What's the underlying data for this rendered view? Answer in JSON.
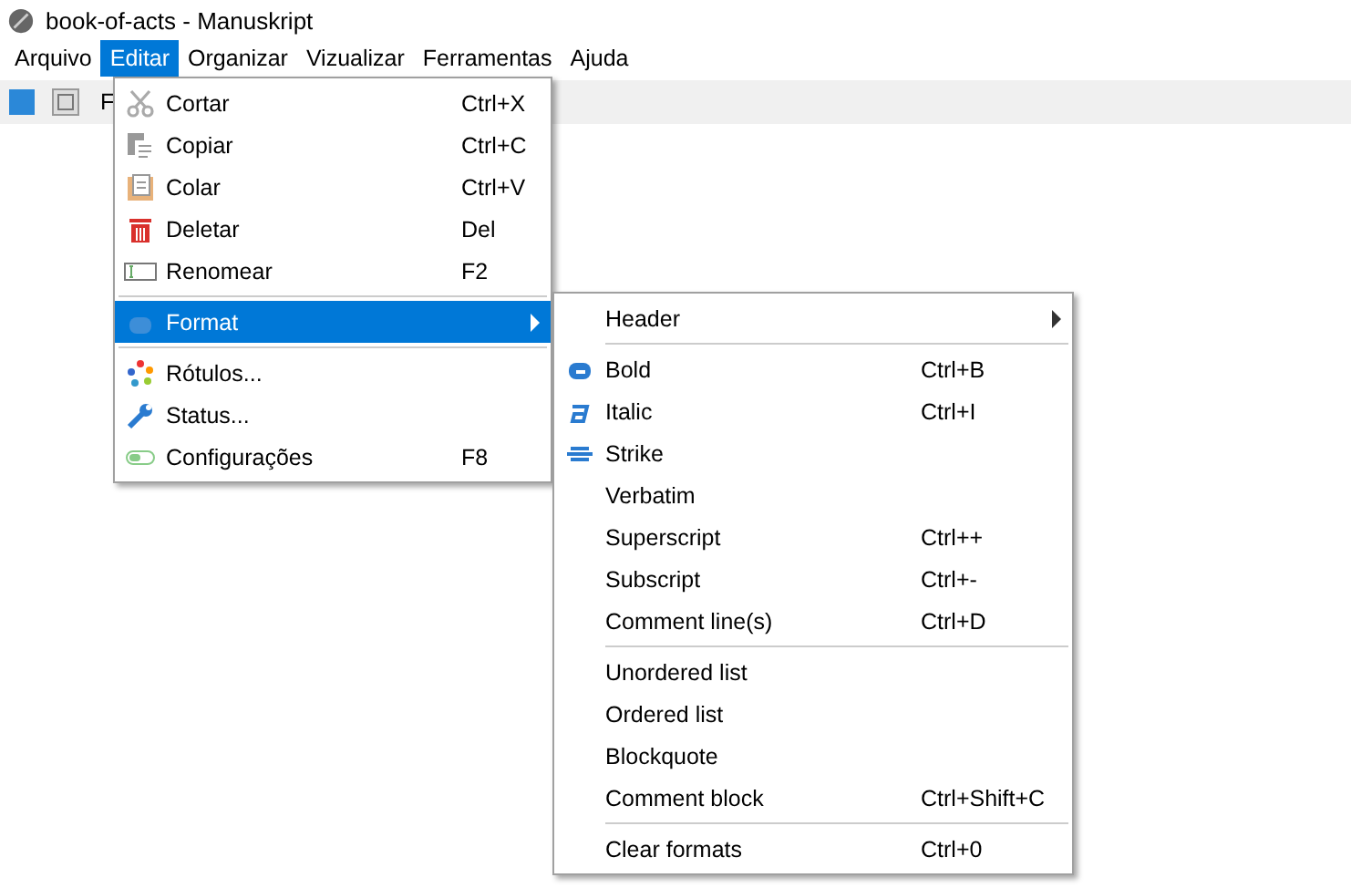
{
  "window": {
    "title": "book-of-acts - Manuskript"
  },
  "menubar": [
    {
      "label": "Arquivo",
      "selected": false
    },
    {
      "label": "Editar",
      "selected": true
    },
    {
      "label": "Organizar",
      "selected": false
    },
    {
      "label": "Vizualizar",
      "selected": false
    },
    {
      "label": "Ferramentas",
      "selected": false
    },
    {
      "label": "Ajuda",
      "selected": false
    }
  ],
  "toolbar": {
    "label": "F"
  },
  "edit_menu": [
    {
      "kind": "item",
      "label": "Cortar",
      "shortcut": "Ctrl+X",
      "selected": false
    },
    {
      "kind": "item",
      "label": "Copiar",
      "shortcut": "Ctrl+C",
      "selected": false
    },
    {
      "kind": "item",
      "label": "Colar",
      "shortcut": "Ctrl+V",
      "selected": false
    },
    {
      "kind": "item",
      "label": "Deletar",
      "shortcut": "Del",
      "selected": false
    },
    {
      "kind": "item",
      "label": "Renomear",
      "shortcut": "F2",
      "selected": false
    },
    {
      "kind": "separator"
    },
    {
      "kind": "submenu",
      "label": "Format",
      "selected": true
    },
    {
      "kind": "separator"
    },
    {
      "kind": "item",
      "label": "Rótulos...",
      "selected": false
    },
    {
      "kind": "item",
      "label": "Status...",
      "selected": false
    },
    {
      "kind": "item",
      "label": "Configurações",
      "shortcut": "F8",
      "selected": false
    }
  ],
  "format_menu": [
    {
      "kind": "submenu",
      "label": "Header",
      "selected": false
    },
    {
      "kind": "separator"
    },
    {
      "kind": "item",
      "label": "Bold",
      "shortcut": "Ctrl+B",
      "selected": false
    },
    {
      "kind": "item",
      "label": "Italic",
      "shortcut": "Ctrl+I",
      "selected": false
    },
    {
      "kind": "item",
      "label": "Strike",
      "selected": false
    },
    {
      "kind": "item",
      "label": "Verbatim",
      "selected": false
    },
    {
      "kind": "item",
      "label": "Superscript",
      "shortcut": "Ctrl++",
      "selected": false
    },
    {
      "kind": "item",
      "label": "Subscript",
      "shortcut": "Ctrl+-",
      "selected": false
    },
    {
      "kind": "item",
      "label": "Comment line(s)",
      "shortcut": "Ctrl+D",
      "selected": false
    },
    {
      "kind": "separator"
    },
    {
      "kind": "item",
      "label": "Unordered list",
      "selected": false
    },
    {
      "kind": "item",
      "label": "Ordered list",
      "selected": false
    },
    {
      "kind": "item",
      "label": "Blockquote",
      "selected": false
    },
    {
      "kind": "item",
      "label": "Comment block",
      "shortcut": "Ctrl+Shift+C",
      "selected": false
    },
    {
      "kind": "separator"
    },
    {
      "kind": "item",
      "label": "Clear formats",
      "shortcut": "Ctrl+0",
      "selected": false
    }
  ]
}
